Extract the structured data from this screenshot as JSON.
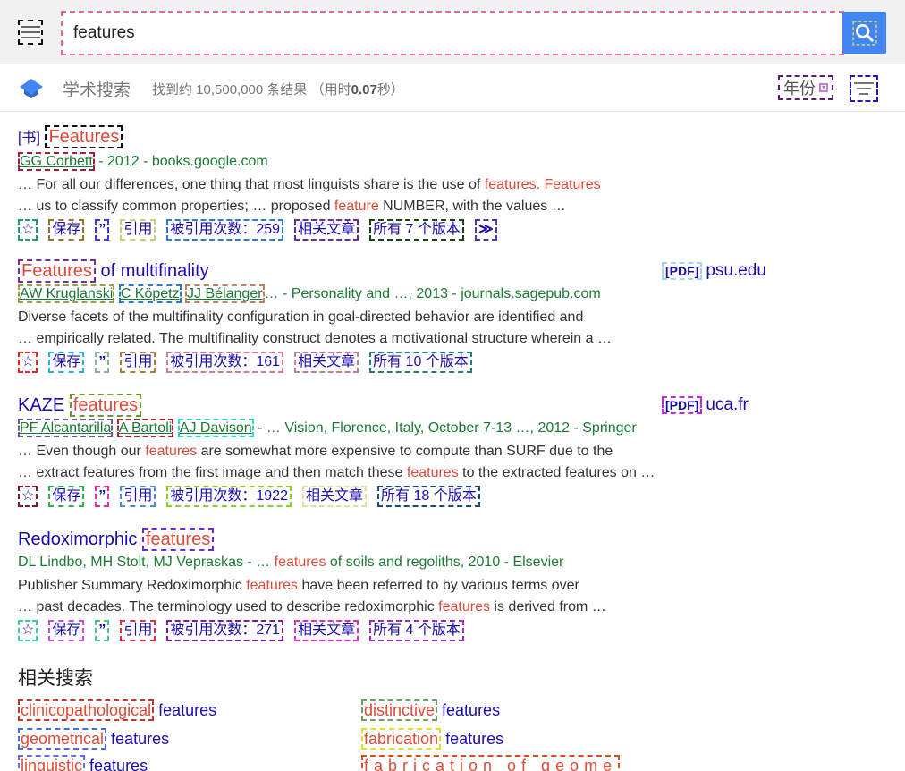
{
  "search": {
    "query": "features",
    "placeholder": ""
  },
  "header": {
    "title": "学术搜索",
    "result_count": "找到约 10,500,000 条结果",
    "time_prefix": "（用时",
    "time_value": "0.07",
    "time_suffix": "秒）",
    "year_label": "年份"
  },
  "results": [
    {
      "tag": "[书]",
      "title_hl": "Features",
      "title_rest": "",
      "authors": [
        "GG Corbett"
      ],
      "meta_rest": " - 2012 - books.google.com",
      "snippet1_pre": "… For all our differences, one thing that most linguists share is the use of ",
      "snippet1_hl": "features. Features",
      "snippet1_post": "",
      "snippet2_pre": "… us to classify common properties; … proposed ",
      "snippet2_hl": "feature",
      "snippet2_post": " NUMBER, with the values …",
      "save": "保存",
      "cite": "引用",
      "cited_by": "被引用次数：259",
      "related": "相关文章",
      "versions": "所有 7 个版本",
      "more": "≫"
    },
    {
      "tag": "",
      "title_hl": "Features",
      "title_rest": " of multifinality",
      "authors": [
        "AW Kruglanski",
        "C Köpetz",
        "JJ Bélanger"
      ],
      "meta_rest": "… - Personality and …, 2013 - journals.sagepub.com",
      "snippet1_pre": "Diverse facets of the multifinality configuration in goal-directed behavior are identified and",
      "snippet1_hl": "",
      "snippet1_post": "",
      "snippet2_pre": "… empirically related. The multifinality construct denotes a motivational structure wherein a …",
      "snippet2_hl": "",
      "snippet2_post": "",
      "save": "保存",
      "cite": "引用",
      "cited_by": "被引用次数：161",
      "related": "相关文章",
      "versions": "所有 10 个版本",
      "pdf_tag": "[PDF]",
      "pdf_source": "psu.edu"
    },
    {
      "tag": "",
      "title_pre": "KAZE ",
      "title_hl": "features",
      "title_rest": "",
      "authors": [
        "PF Alcantarilla",
        "A Bartoli",
        "AJ Davison"
      ],
      "meta_rest": " - … Vision, Florence, Italy, October 7-13 …, 2012 - Springer",
      "snippet1_pre": "… Even though our ",
      "snippet1_hl": "features",
      "snippet1_post": " are somewhat more expensive to compute than SURF due to the",
      "snippet2_pre": "… extract features from the first image and then match these ",
      "snippet2_hl": "features",
      "snippet2_post": " to the extracted features on …",
      "save": "保存",
      "cite": "引用",
      "cited_by": "被引用次数：1922",
      "related": "相关文章",
      "versions": "所有 18 个版本",
      "pdf_tag": "[PDF]",
      "pdf_source": "uca.fr"
    },
    {
      "tag": "",
      "title_pre": "Redoximorphic ",
      "title_hl": "features",
      "title_rest": "",
      "authors_text": "DL Lindbo, MH Stolt, MJ Vepraskas - … ",
      "meta_hl": "features",
      "meta_rest": " of soils and regoliths, 2010 - Elsevier",
      "snippet1_pre": "Publisher Summary Redoximorphic ",
      "snippet1_hl": "features",
      "snippet1_post": " have been referred to by various terms over",
      "snippet2_pre": "… past decades. The terminology used to describe redoximorphic ",
      "snippet2_hl": "features",
      "snippet2_post": " is derived from …",
      "save": "保存",
      "cite": "引用",
      "cited_by": "被引用次数：271",
      "related": "相关文章",
      "versions": "所有 4 个版本"
    }
  ],
  "related_searches": {
    "title": "相关搜索",
    "items": [
      {
        "hl": "clinicopathological",
        "rest": " features"
      },
      {
        "hl": "geometrical",
        "rest": " features"
      },
      {
        "hl": "linguistic",
        "rest": " features"
      },
      {
        "hl": "distinctive",
        "rest": " features"
      },
      {
        "hl": "fabrication",
        "rest": " features"
      },
      {
        "hl": "fabrication of geome",
        "rest": ""
      }
    ]
  },
  "colors": {
    "accent": "#4285f4",
    "link": "#1a0dab",
    "highlight": "#dd4b39",
    "meta": "#1a7a33"
  }
}
